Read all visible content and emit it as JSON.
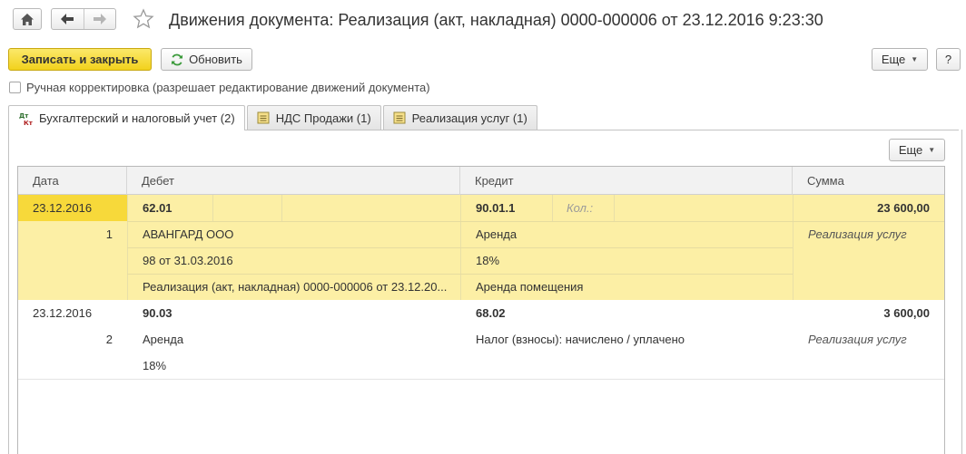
{
  "window": {
    "title": "Движения документа: Реализация (акт, накладная) 0000-000006 от 23.12.2016 9:23:30"
  },
  "toolbar": {
    "save_close_label": "Записать и закрыть",
    "refresh_label": "Обновить",
    "more_label": "Еще",
    "help_label": "?"
  },
  "manual_edit": {
    "label": "Ручная корректировка (разрешает редактирование движений документа)",
    "checked": false
  },
  "tabs": [
    {
      "label": "Бухгалтерский и налоговый учет (2)",
      "active": true,
      "icon": "accounting-dt-kt-icon"
    },
    {
      "label": "НДС Продажи (1)",
      "active": false,
      "icon": "register-icon"
    },
    {
      "label": "Реализация услуг (1)",
      "active": false,
      "icon": "register-icon"
    }
  ],
  "grid": {
    "more_label": "Еще",
    "columns": [
      "Дата",
      "Дебет",
      "Кредит",
      "Сумма"
    ],
    "records": [
      {
        "date": "23.12.2016",
        "number": "1",
        "debit_account": "62.01",
        "debit_subconto": [
          "АВАНГАРД ООО",
          "98 от 31.03.2016",
          "Реализация (акт, накладная) 0000-000006 от 23.12.20..."
        ],
        "credit_account": "90.01.1",
        "credit_qty_label": "Кол.:",
        "credit_subconto": [
          "Аренда",
          "18%",
          "Аренда помещения"
        ],
        "amount": "23 600,00",
        "content": "Реализация услуг",
        "selected": true
      },
      {
        "date": "23.12.2016",
        "number": "2",
        "debit_account": "90.03",
        "debit_subconto": [
          "Аренда",
          "18%"
        ],
        "credit_account": "68.02",
        "credit_subconto": [
          "Налог (взносы): начислено / уплачено"
        ],
        "amount": "3 600,00",
        "content": "Реализация услуг",
        "selected": false
      }
    ]
  },
  "colors": {
    "selected_row": "#fcefa5",
    "selected_cell": "#f7d93a",
    "primary_button": "#f2d21c"
  }
}
